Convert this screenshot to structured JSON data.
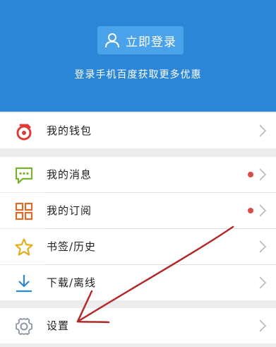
{
  "header": {
    "login_label": "立即登录",
    "tagline": "登录手机百度获取更多优惠"
  },
  "menu": {
    "wallet": "我的钱包",
    "messages": "我的消息",
    "subscriptions": "我的订阅",
    "bookmarks": "书签/历史",
    "downloads": "下载/离线",
    "settings": "设置"
  },
  "colors": {
    "header_bg": "#2b86d8",
    "accent_red": "#dd4b48",
    "annotation": "#b32a2a"
  },
  "icons": {
    "user": "user-icon",
    "wallet": "wallet-icon",
    "messages": "chat-bubble-icon",
    "subscriptions": "grid-icon",
    "bookmarks": "star-icon",
    "downloads": "download-icon",
    "settings": "gear-icon",
    "chevron": "chevron-right-icon"
  }
}
